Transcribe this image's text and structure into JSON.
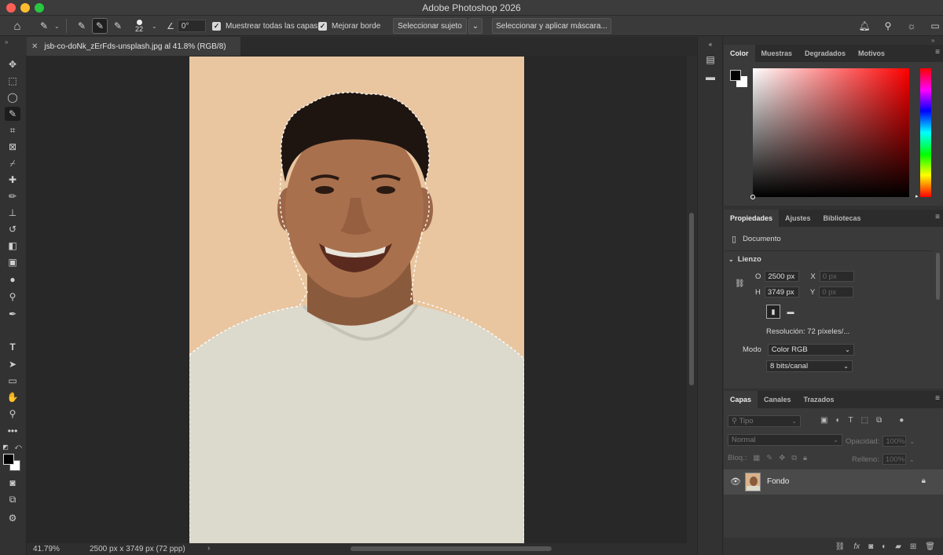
{
  "window": {
    "title": "Adobe Photoshop 2026"
  },
  "options_bar": {
    "brush_size": "22",
    "angle_value": "0°",
    "sample_all_layers": "Muestrear todas las capas",
    "enhance_edge": "Mejorar borde",
    "select_subject": "Seleccionar sujeto",
    "select_and_mask": "Seleccionar y aplicar máscara..."
  },
  "document": {
    "tab_title": "jsb-co-doNk_zErFds-unsplash.jpg al 41.8% (RGB/8)",
    "zoom": "41.79%",
    "info": "2500 px x 3749 px (72 ppp)"
  },
  "color_panel": {
    "tabs": [
      "Color",
      "Muestras",
      "Degradados",
      "Motivos"
    ],
    "foreground": "#000000",
    "background": "#ffffff",
    "hue_color": "#ff0000"
  },
  "properties_panel": {
    "tabs": [
      "Propiedades",
      "Ajustes",
      "Bibliotecas"
    ],
    "type_label": "Documento",
    "section": "Lienzo",
    "width_label": "O",
    "width_value": "2500 px",
    "height_label": "H",
    "height_value": "3749 px",
    "x_label": "X",
    "x_value": "0 px",
    "y_label": "Y",
    "y_value": "0 px",
    "resolution": "Resolución: 72 píxeles/...",
    "mode_label": "Modo",
    "mode_value": "Color RGB",
    "bits_value": "8 bits/canal"
  },
  "layers_panel": {
    "tabs": [
      "Capas",
      "Canales",
      "Trazados"
    ],
    "filter_placeholder": "Tipo",
    "blend_mode": "Normal",
    "opacity_label": "Opacidad:",
    "opacity_value": "100%",
    "lock_label": "Bloq.:",
    "fill_label": "Relleno:",
    "fill_value": "100%",
    "layers": [
      {
        "name": "Fondo",
        "visible": true,
        "locked": true
      }
    ]
  }
}
